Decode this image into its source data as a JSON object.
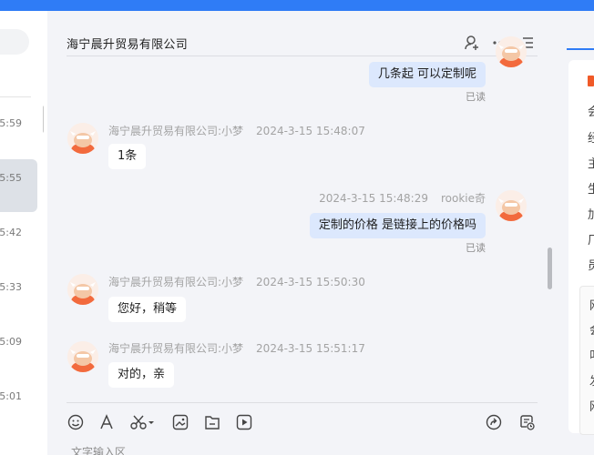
{
  "chat": {
    "title": "海宁晨升贸易有限公司",
    "input_placeholder": "文字输入区"
  },
  "conversation_times": [
    "5:59",
    "5:55",
    "5:42",
    "5:33",
    "5:09",
    "5:01"
  ],
  "messages": [
    {
      "text": "几条起 可以定制呢",
      "read": "已读"
    },
    {
      "sender": "海宁晨升贸易有限公司:小梦",
      "time": "2024-3-15 15:48:07",
      "text": "1条"
    },
    {
      "sender": "rookie奇",
      "time": "2024-3-15 15:48:29",
      "text": "定制的价格 是链接上的价格吗",
      "read": "已读"
    },
    {
      "sender": "海宁晨升贸易有限公司:小梦",
      "time": "2024-3-15 15:50:30",
      "text": "您好，稍等"
    },
    {
      "sender": "海宁晨升贸易有限公司:小梦",
      "time": "2024-3-15 15:51:17",
      "text": "对的，亲"
    }
  ],
  "right_panel_chars": [
    "会",
    "经",
    "主",
    "生",
    "加",
    "厂",
    "员"
  ],
  "right_panel_sub_chars": [
    "网",
    "会",
    "叫",
    "发",
    "网"
  ],
  "icons": {
    "header": [
      "add-user-icon",
      "more-icon",
      "list-icon"
    ],
    "toolbar": [
      "emoji-icon",
      "font-icon",
      "scissors-icon",
      "image-icon",
      "file-icon",
      "video-icon",
      "share-icon",
      "history-icon"
    ]
  },
  "colors": {
    "accent": "#2f7cf6",
    "outgoing_bubble": "#dce8fd",
    "incoming_bubble": "#ffffff"
  }
}
